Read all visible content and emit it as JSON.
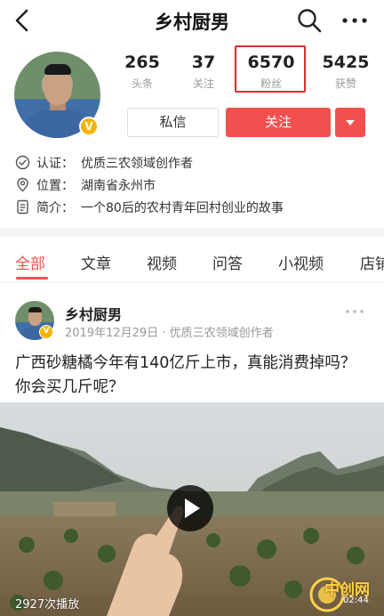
{
  "header": {
    "title": "乡村厨男"
  },
  "profile": {
    "badge_glyph": "V",
    "stats": [
      {
        "value": "265",
        "label": "头条"
      },
      {
        "value": "37",
        "label": "关注"
      },
      {
        "value": "6570",
        "label": "粉丝"
      },
      {
        "value": "5425",
        "label": "获赞"
      }
    ],
    "message_label": "私信",
    "follow_label": "关注",
    "info": [
      {
        "icon": "verified-icon",
        "key": "认证：",
        "value": "优质三农领域创作者"
      },
      {
        "icon": "location-pin-icon",
        "key": "位置：",
        "value": "湖南省永州市"
      },
      {
        "icon": "document-icon",
        "key": "简介：",
        "value": "一个80后的农村青年回村创业的故事"
      }
    ]
  },
  "tabs": [
    {
      "label": "全部",
      "active": true
    },
    {
      "label": "文章",
      "active": false
    },
    {
      "label": "视频",
      "active": false
    },
    {
      "label": "问答",
      "active": false
    },
    {
      "label": "小视频",
      "active": false
    },
    {
      "label": "店铺",
      "active": false
    }
  ],
  "post": {
    "author": "乡村厨男",
    "meta": "2019年12月29日 · 优质三农领域创作者",
    "text": "广西砂糖橘今年有140亿斤上市，真能消费掉吗？你会买几斤呢？",
    "play_count": "2927次播放",
    "duration": "02:44",
    "watermark": "中创网"
  },
  "colors": {
    "accent": "#f2504f",
    "highlight_box": "#d9302a",
    "badge": "#f3b500"
  }
}
